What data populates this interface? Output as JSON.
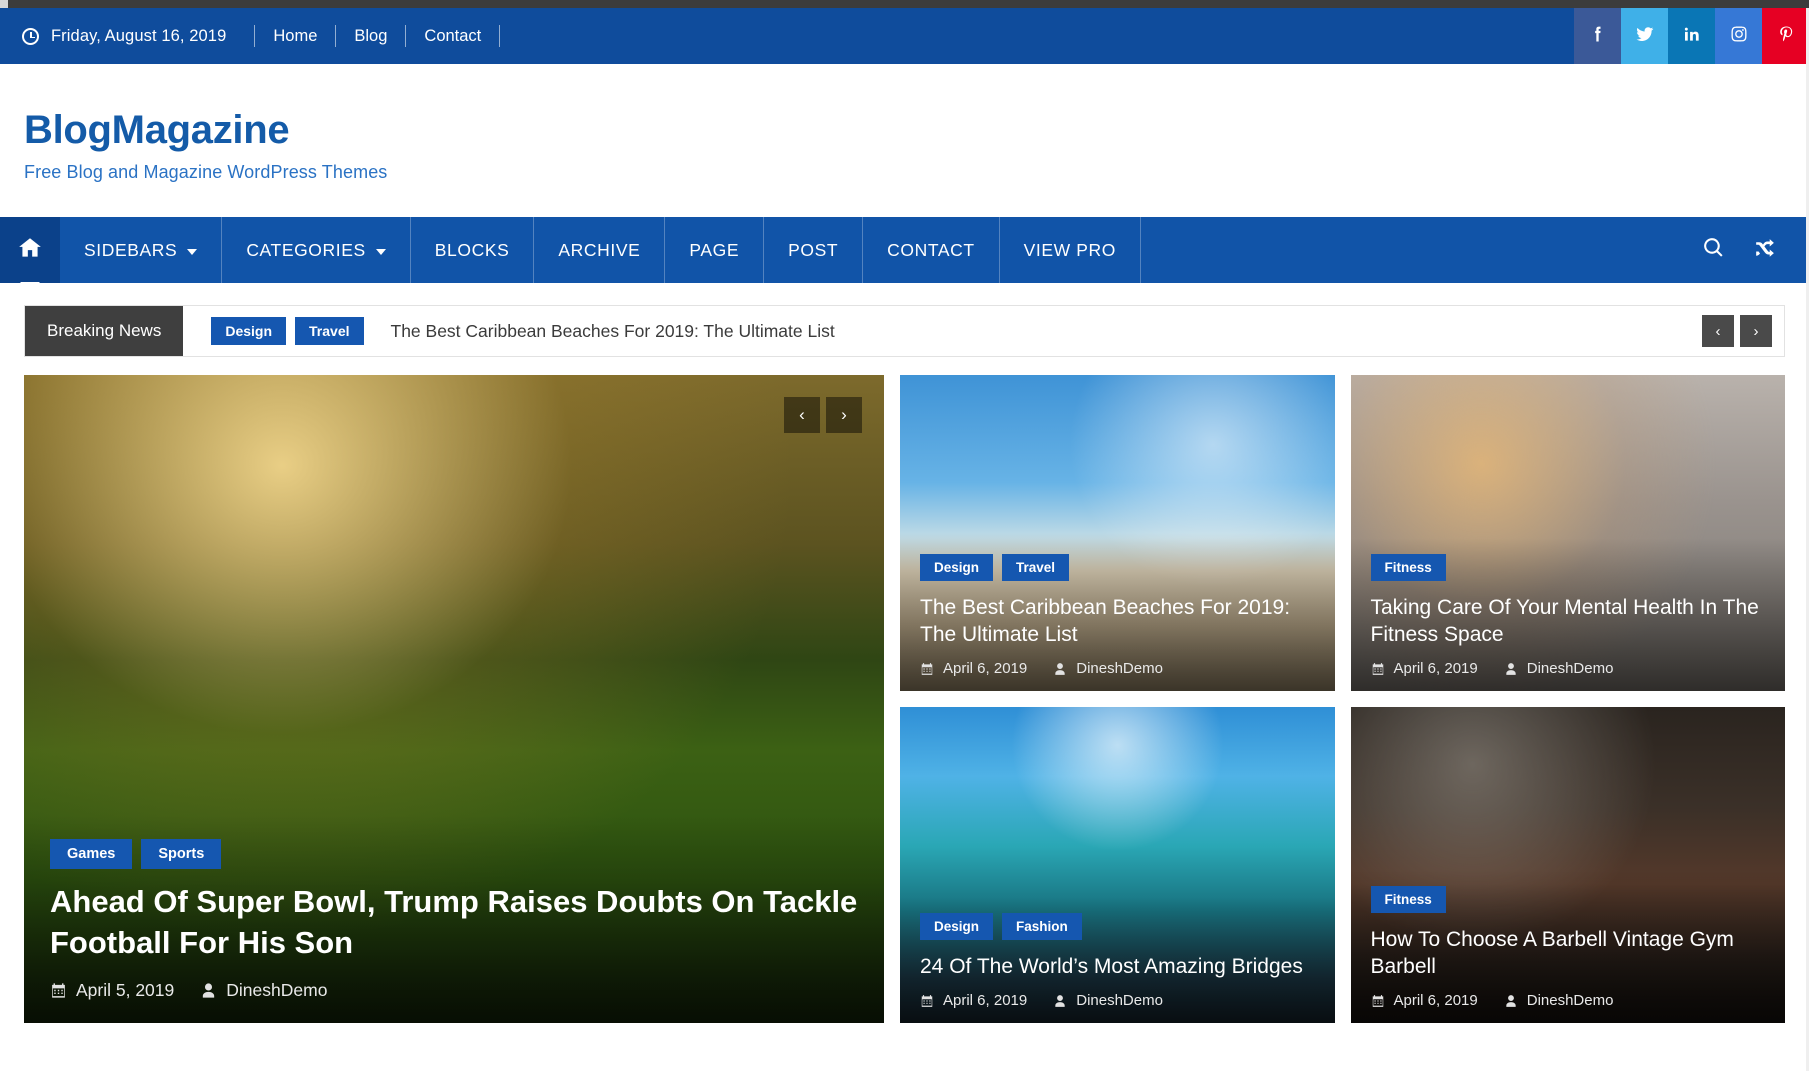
{
  "topbar": {
    "clock_icon": "clock-icon",
    "date": "Friday, August 16, 2019",
    "links": [
      {
        "label": "Home"
      },
      {
        "label": "Blog"
      },
      {
        "label": "Contact"
      }
    ],
    "social": [
      {
        "name": "facebook-icon",
        "label": "Facebook",
        "color": "#3b5998"
      },
      {
        "name": "twitter-icon",
        "label": "Twitter",
        "color": "#3fb0e8"
      },
      {
        "name": "linkedin-icon",
        "label": "LinkedIn",
        "color": "#0a76b5"
      },
      {
        "name": "instagram-icon",
        "label": "Instagram",
        "color": "#3678d6"
      },
      {
        "name": "pinterest-icon",
        "label": "Pinterest",
        "color": "#e60023"
      }
    ]
  },
  "brand": {
    "title": "BlogMagazine",
    "tagline": "Free Blog and Magazine WordPress Themes",
    "title_color": "#145ba8"
  },
  "mainnav": {
    "home_icon": "home-icon",
    "items": [
      {
        "label": "SIDEBARS",
        "has_dropdown": true
      },
      {
        "label": "CATEGORIES",
        "has_dropdown": true
      },
      {
        "label": "BLOCKS",
        "has_dropdown": false
      },
      {
        "label": "ARCHIVE",
        "has_dropdown": false
      },
      {
        "label": "PAGE",
        "has_dropdown": false
      },
      {
        "label": "POST",
        "has_dropdown": false
      },
      {
        "label": "CONTACT",
        "has_dropdown": false
      },
      {
        "label": "VIEW PRO",
        "has_dropdown": false
      }
    ],
    "search_icon": "search-icon",
    "random_icon": "shuffle-icon",
    "bg_color": "#1154a8",
    "active_bg_color": "#0b418a"
  },
  "breaking_news": {
    "label": "Breaking News",
    "tags": [
      "Design",
      "Travel"
    ],
    "headline": "The Best Caribbean Beaches For 2019: The Ultimate List",
    "prev_label": "‹",
    "next_label": "›",
    "label_bg": "#3f3f3f",
    "tag_bg": "#1557b0"
  },
  "featured": {
    "slider_prev": "‹",
    "slider_next": "›",
    "main": {
      "tags": [
        "Games",
        "Sports"
      ],
      "title": "Ahead Of Super Bowl, Trump Raises Doubts On Tackle Football For His Son",
      "date": "April 5, 2019",
      "author": "DineshDemo",
      "date_icon": "calendar-icon",
      "author_icon": "user-icon",
      "image_alt": "soccer-player-photo"
    },
    "cards": [
      {
        "tags": [
          "Design",
          "Travel"
        ],
        "title": "The Best Caribbean Beaches For 2019: The Ultimate List",
        "date": "April 6, 2019",
        "author": "DineshDemo",
        "image_alt": "palm-tree-beach-photo"
      },
      {
        "tags": [
          "Fitness"
        ],
        "title": "Taking Care Of Your Mental Health In The Fitness Space",
        "date": "April 6, 2019",
        "author": "DineshDemo",
        "image_alt": "woman-plank-beach-photo"
      },
      {
        "tags": [
          "Design",
          "Fashion"
        ],
        "title": "24 Of The World’s Most Amazing Bridges",
        "date": "April 6, 2019",
        "author": "DineshDemo",
        "image_alt": "wooden-pier-ocean-photo"
      },
      {
        "tags": [
          "Fitness"
        ],
        "title": "How To Choose A Barbell Vintage Gym Barbell",
        "date": "April 6, 2019",
        "author": "DineshDemo",
        "image_alt": "dumbbells-gym-photo"
      }
    ]
  }
}
